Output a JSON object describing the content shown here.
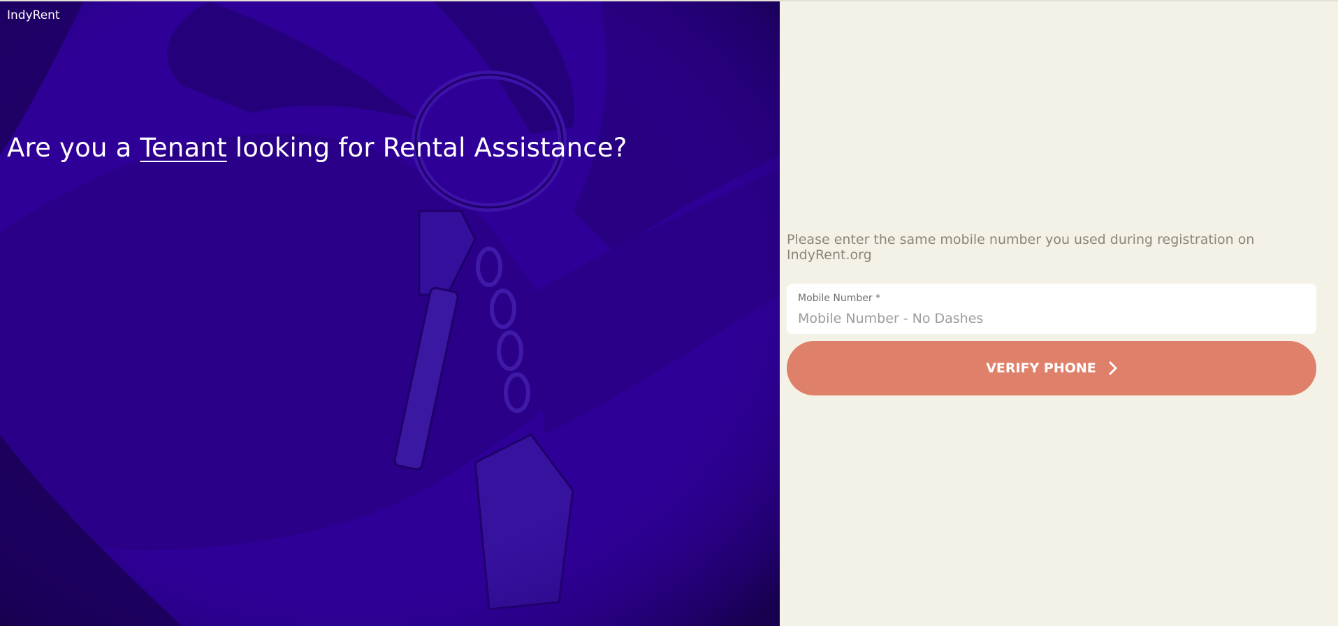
{
  "brand": {
    "name": "IndyRent"
  },
  "hero": {
    "headline_before": "Are you a ",
    "headline_emphasis": "Tenant",
    "headline_after": " looking for Rental Assistance?"
  },
  "form": {
    "instructions": "Please enter the same mobile number you used during registration on IndyRent.org",
    "mobile_label": "Mobile Number *",
    "mobile_placeholder": "Mobile Number - No Dashes",
    "mobile_value": "",
    "submit_label": "VERIFY PHONE",
    "submit_icon": "chevron-right-icon"
  },
  "colors": {
    "hero_bg": "#2f0098",
    "panel_bg": "#f4f2e6",
    "button_bg": "#df806b",
    "instructions_text": "#8a8578"
  }
}
